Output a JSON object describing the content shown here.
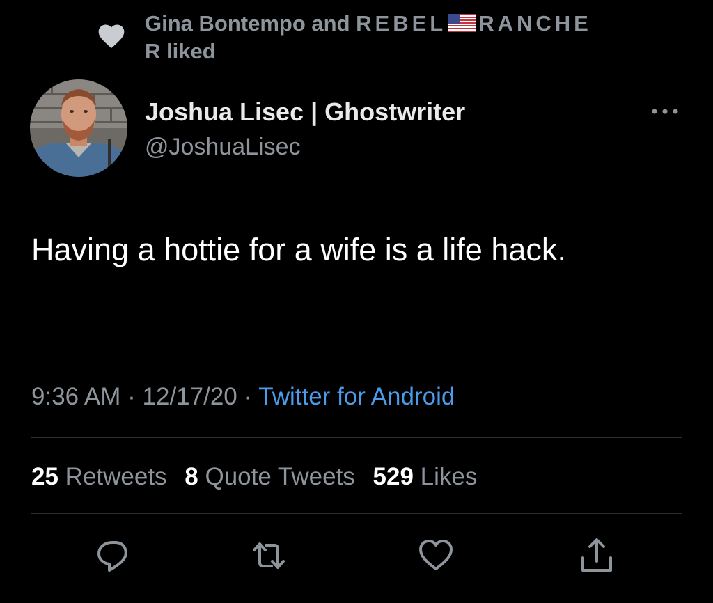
{
  "social_context": {
    "prefix": "Gina Bontempo and ",
    "name_part1": "REBEL",
    "name_part2": "RANCHE",
    "line2": "R liked",
    "icon": "heart-icon",
    "flag_icon": "us-flag-emoji"
  },
  "tweet": {
    "author_name": "Joshua Lisec | Ghostwriter",
    "author_handle": "@JoshuaLisec",
    "text": "Having a hottie for a wife is a life hack.",
    "time": "9:36 AM",
    "separator1": " · ",
    "date": "12/17/20",
    "separator2": " · ",
    "source": "Twitter for Android"
  },
  "stats": {
    "retweets_count": "25",
    "retweets_label": " Retweets",
    "quotes_count": "8",
    "quotes_label": " Quote Tweets",
    "likes_count": "529",
    "likes_label": " Likes"
  },
  "actions": {
    "reply_icon": "reply-icon",
    "retweet_icon": "retweet-icon",
    "like_icon": "like-heart-icon",
    "share_icon": "share-icon"
  },
  "colors": {
    "background": "#000000",
    "secondary_text": "#8e949b",
    "link_blue": "#4b9be8",
    "divider": "#2b2f33"
  }
}
